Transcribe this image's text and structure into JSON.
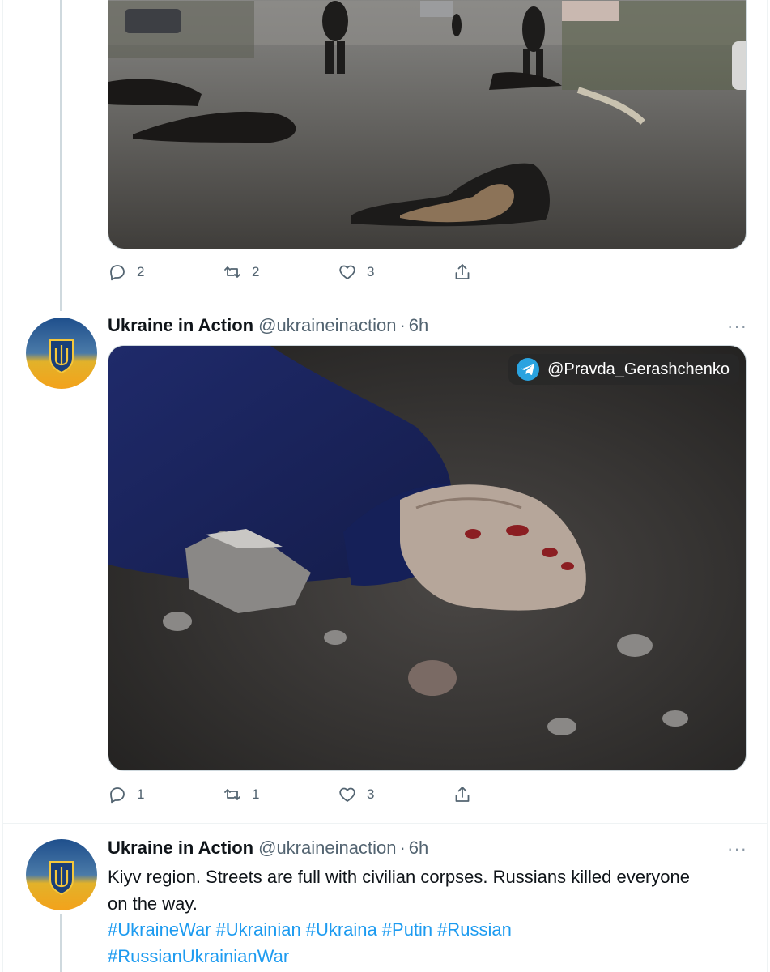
{
  "colors": {
    "text": "#0f1419",
    "muted": "#536471",
    "link": "#1d9bf0",
    "telegram": "#2aa3e0"
  },
  "tweet_prev": {
    "actions": {
      "replies": "2",
      "retweets": "2",
      "likes": "3"
    }
  },
  "tweet_1": {
    "author": "Ukraine in Action",
    "handle": "@ukraineinaction",
    "separator": "·",
    "time": "6h",
    "more": "···",
    "media_badge": "@Pravda_Gerashchenko",
    "actions": {
      "replies": "1",
      "retweets": "1",
      "likes": "3"
    }
  },
  "tweet_2": {
    "author": "Ukraine in Action",
    "handle": "@ukraineinaction",
    "separator": "·",
    "time": "6h",
    "more": "···",
    "text_line1": "Kiyv region. Streets are full with civilian corpses. Russians killed everyone",
    "text_line2": "on the way.",
    "hashtags_line1": [
      "#UkraineWar",
      "#Ukrainian",
      "#Ukraina",
      "#Putin",
      "#Russian"
    ],
    "hashtags_line2": [
      "#RussianUkrainianWar"
    ]
  },
  "icons": {
    "reply": "reply-icon",
    "retweet": "retweet-icon",
    "like": "like-icon",
    "share": "share-icon",
    "telegram": "telegram-icon",
    "avatar": "ukraine-trident-avatar"
  }
}
